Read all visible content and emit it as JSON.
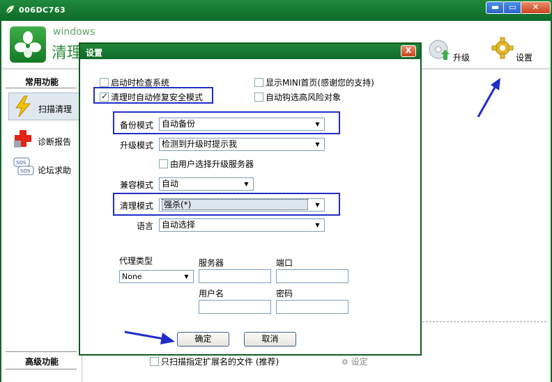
{
  "window": {
    "title": "006DC763",
    "brand_small": "windows",
    "brand_big": "清理"
  },
  "header": {
    "upgrade_label": "升级",
    "settings_label": "设置"
  },
  "sidebar": {
    "section_common": "常用功能",
    "items": [
      {
        "label": "扫描清理",
        "icon": "lightning-icon"
      },
      {
        "label": "诊断报告",
        "icon": "red-cross-icon"
      },
      {
        "label": "论坛求助",
        "icon": "sos-icon"
      }
    ],
    "section_advanced": "高级功能"
  },
  "main": {
    "scan_ext_label": "只扫描指定扩展名的文件 (推荐)",
    "setting_link": "设定"
  },
  "dialog": {
    "title": "设置",
    "close": "X",
    "checkboxes": {
      "startup_check": "启动时检查系统",
      "show_mini": "显示MINI首页(感谢您的支持)",
      "auto_repair": "清理时自动修复安全模式",
      "auto_risk": "自动钩选高风险对象",
      "user_select_server": "由用户选择升级服务器"
    },
    "backup_label": "备份模式",
    "backup_value": "自动备份",
    "upgrade_label": "升级模式",
    "upgrade_value": "检测到升级时提示我",
    "compat_label": "兼容模式",
    "compat_value": "自动",
    "clean_label": "清理模式",
    "clean_value": "强杀(*)",
    "lang_label": "语言",
    "lang_value": "自动选择",
    "proxy_type_label": "代理类型",
    "proxy_type_value": "None",
    "server_label": "服务器",
    "port_label": "端口",
    "username_label": "用户名",
    "password_label": "密码",
    "ok": "确定",
    "cancel": "取消"
  },
  "colors": {
    "title_green": "#0f6a28",
    "highlight_blue": "#1f2cc9"
  }
}
